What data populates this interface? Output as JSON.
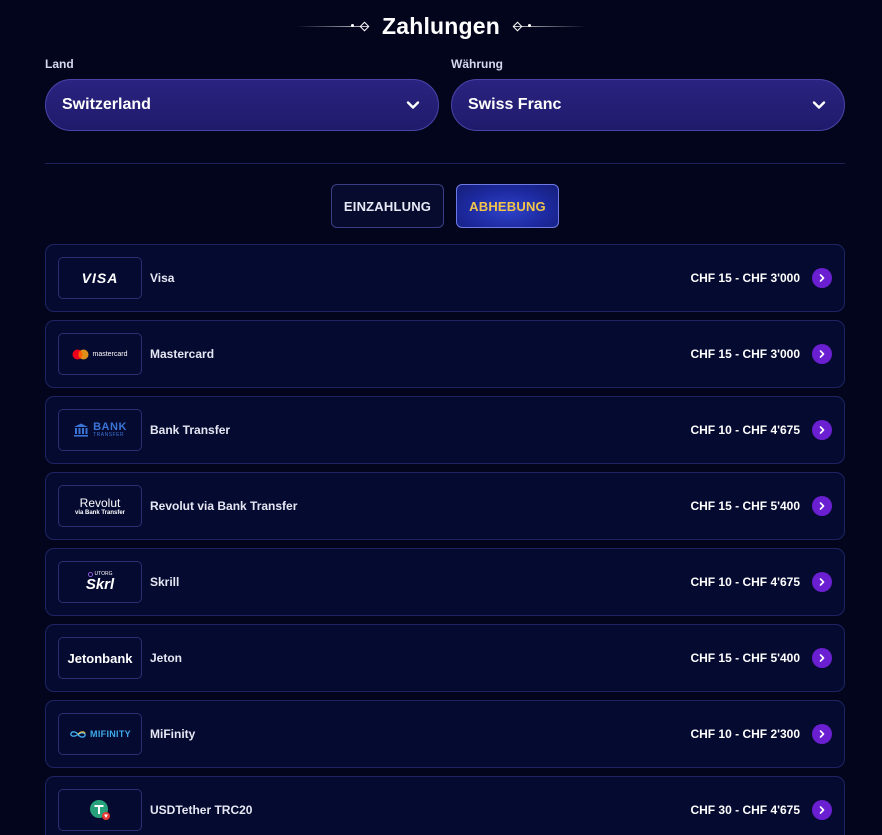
{
  "header": {
    "title": "Zahlungen"
  },
  "filters": {
    "country": {
      "label": "Land",
      "value": "Switzerland"
    },
    "currency": {
      "label": "Währung",
      "value": "Swiss Franc"
    }
  },
  "tabs": [
    {
      "label": "EINZAHLUNG",
      "active": false
    },
    {
      "label": "ABHEBUNG",
      "active": true
    }
  ],
  "colors": {
    "background": "#03051c",
    "active_tab_text": "#f2c54a",
    "arrow_button": "#6a1fd1",
    "select_background": "#2a2380"
  },
  "payments": [
    {
      "name": "Visa",
      "limits": "CHF 15 - CHF 3'000",
      "logo": "visa-logo",
      "logo_text": "VISA"
    },
    {
      "name": "Mastercard",
      "limits": "CHF 15 - CHF 3'000",
      "logo": "mastercard-logo",
      "logo_text": "mastercard"
    },
    {
      "name": "Bank Transfer",
      "limits": "CHF 10 - CHF 4'675",
      "logo": "bank-transfer-logo",
      "logo_text": "BANK",
      "logo_subtext": "TRANSFER"
    },
    {
      "name": "Revolut via Bank Transfer",
      "limits": "CHF 15 - CHF 5'400",
      "logo": "revolut-logo",
      "logo_text": "Revolut",
      "logo_subtext": "via Bank Transfer"
    },
    {
      "name": "Skrill",
      "limits": "CHF 10 - CHF 4'675",
      "logo": "skrill-logo",
      "logo_text": "Skrl",
      "logo_subtext": "UTORG"
    },
    {
      "name": "Jeton",
      "limits": "CHF 15 - CHF 5'400",
      "logo": "jeton-logo",
      "logo_text": "Jetonbank"
    },
    {
      "name": "MiFinity",
      "limits": "CHF 10 - CHF 2'300",
      "logo": "mifinity-logo",
      "logo_text": "MIFINITY"
    },
    {
      "name": "USDTether TRC20",
      "limits": "CHF 30 - CHF 4'675",
      "logo": "usdt-logo"
    }
  ]
}
